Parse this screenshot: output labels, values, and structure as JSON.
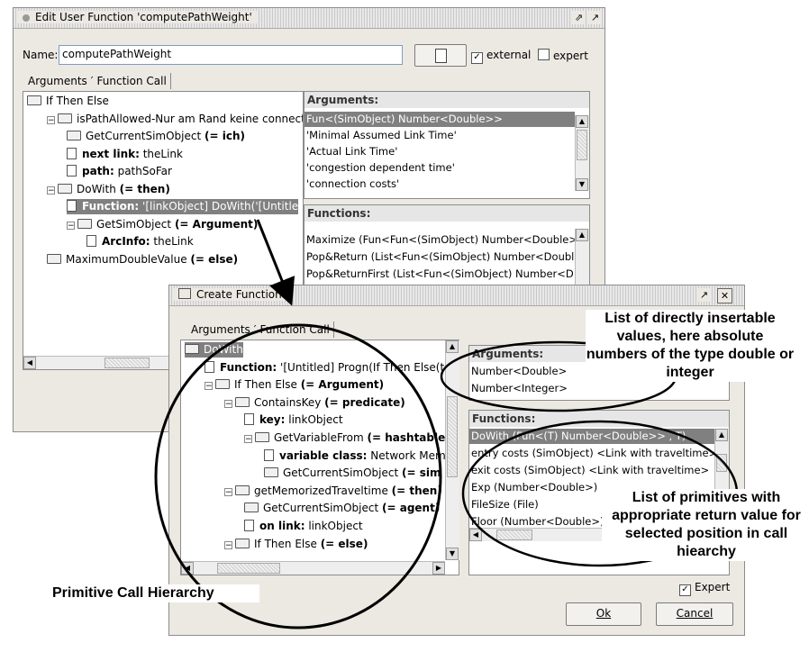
{
  "back_window": {
    "title": "Edit User Function 'computePathWeight'",
    "name_label": "Name:",
    "name_value": "computePathWeight",
    "external_label": "external",
    "external_checked": true,
    "expert_label": "expert",
    "expert_checked": false,
    "tabs": [
      "Arguments",
      "Function Call"
    ],
    "tree": [
      {
        "indent": 0,
        "kind": "folder",
        "text": "If Then Else",
        "bold": "",
        "pm": ""
      },
      {
        "indent": 1,
        "kind": "folder",
        "text": "isPathAllowed-Nur am Rand keine connects (",
        "bold": "",
        "pm": "-"
      },
      {
        "indent": 2,
        "kind": "folder",
        "text": "GetCurrentSimObject ",
        "bold": "(= ich)",
        "pm": ""
      },
      {
        "indent": 2,
        "kind": "doc",
        "text": "",
        "bold": "next link:",
        "after": " theLink",
        "pm": ""
      },
      {
        "indent": 2,
        "kind": "doc",
        "text": "",
        "bold": "path:",
        "after": " pathSoFar",
        "pm": ""
      },
      {
        "indent": 1,
        "kind": "folder",
        "text": "DoWith ",
        "bold": "(= then)",
        "pm": "-"
      },
      {
        "indent": 2,
        "kind": "doc",
        "text": "",
        "bold": "Function:",
        "after": " '[linkObject] DoWith('[Untitle",
        "pm": "",
        "selected": true
      },
      {
        "indent": 2,
        "kind": "folder",
        "text": "GetSimObject ",
        "bold": "(= Argument)",
        "pm": "-"
      },
      {
        "indent": 3,
        "kind": "doc",
        "text": "",
        "bold": "ArcInfo:",
        "after": " theLink",
        "pm": ""
      },
      {
        "indent": 1,
        "kind": "folder",
        "text": "MaximumDoubleValue ",
        "bold": "(= else)",
        "pm": ""
      }
    ],
    "arguments_header": "Arguments:",
    "arguments": [
      "Fun<(SimObject) Number<Double>>",
      "'Minimal Assumed Link Time'",
      "'Actual Link Time'",
      "'congestion dependent time'",
      "'connection costs'"
    ],
    "functions_header": "Functions:",
    "functions": [
      "Maximize (Fun<Fun<(SimObject) Number<Double>>",
      "Pop&Return (List<Fun<(SimObject) Number<Doubl",
      "Pop&ReturnFirst (List<Fun<(SimObject) Number<D"
    ]
  },
  "front_window": {
    "title": "Create Function",
    "tabs": [
      "Arguments",
      "Function Call"
    ],
    "tree": [
      {
        "indent": 0,
        "kind": "folder",
        "text": "DoWith",
        "bold": "",
        "pm": "",
        "selected": true
      },
      {
        "indent": 1,
        "kind": "doc",
        "text": "",
        "bold": "Function:",
        "after": " '[Untitled] Progn(If Then Else(t",
        "pm": ""
      },
      {
        "indent": 1,
        "kind": "folder",
        "text": "If Then Else ",
        "bold": "(= Argument)",
        "pm": "-"
      },
      {
        "indent": 2,
        "kind": "folder",
        "text": "ContainsKey ",
        "bold": "(= predicate)",
        "pm": "-"
      },
      {
        "indent": 3,
        "kind": "doc",
        "text": "",
        "bold": "key:",
        "after": " linkObject",
        "pm": ""
      },
      {
        "indent": 3,
        "kind": "folder",
        "text": "GetVariableFrom ",
        "bold": "(= hashtable)",
        "pm": "-"
      },
      {
        "indent": 4,
        "kind": "doc",
        "text": "",
        "bold": "variable class:",
        "after": " Network Mem",
        "pm": ""
      },
      {
        "indent": 4,
        "kind": "folder",
        "text": "GetCurrentSimObject ",
        "bold": "(= sim",
        "pm": ""
      },
      {
        "indent": 2,
        "kind": "folder",
        "text": "getMemorizedTraveltime ",
        "bold": "(= then)",
        "pm": "-"
      },
      {
        "indent": 3,
        "kind": "folder",
        "text": "GetCurrentSimObject ",
        "bold": "(= agent)",
        "pm": ""
      },
      {
        "indent": 3,
        "kind": "doc",
        "text": "",
        "bold": "on link:",
        "after": " linkObject",
        "pm": ""
      },
      {
        "indent": 2,
        "kind": "folder",
        "text": "If Then Else ",
        "bold": "(= else)",
        "pm": "-"
      }
    ],
    "arguments_header": "Arguments:",
    "arguments": [
      "Number<Double>",
      "Number<Integer>"
    ],
    "functions_header": "Functions:",
    "functions": [
      "DoWith (Fun<(T) Number<Double>> , T)",
      "entry costs (SimObject) <Link with traveltime>",
      "exit costs (SimObject) <Link with traveltime>",
      "Exp (Number<Double>)",
      "FileSize (File)",
      "Floor (Number<Double>)"
    ],
    "expert_label": "Expert",
    "expert_checked": true,
    "ok_label": "Ok",
    "cancel_label": "Cancel"
  },
  "annotations": {
    "values": "List of directly insertable values, here absolute numbers of the type double or integer",
    "primitives": "List of primitives with appropriate return value for selected position in call hiearchy",
    "hierarchy": "Primitive Call Hierarchy"
  }
}
